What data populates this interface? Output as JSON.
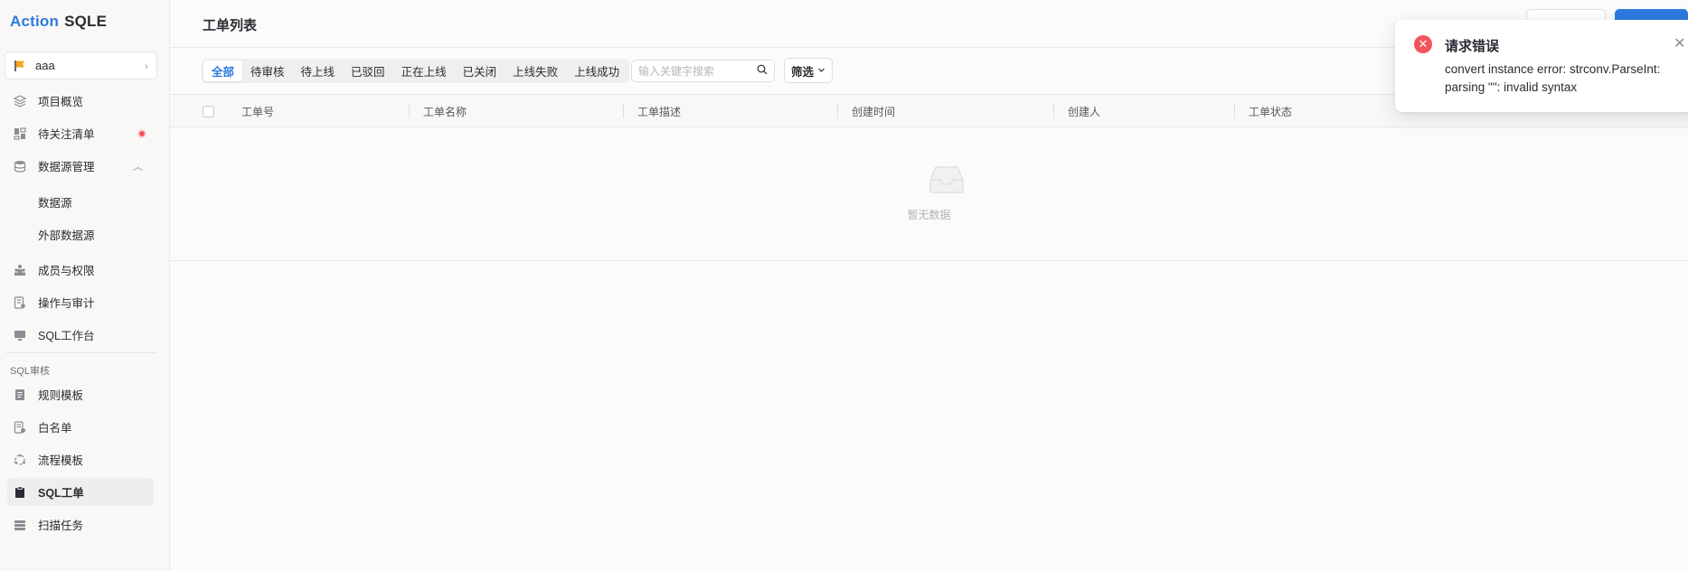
{
  "logo": {
    "brand": "Action",
    "product": "SQLE"
  },
  "project": {
    "name": "aaa"
  },
  "sidebar": {
    "items": [
      {
        "label": "项目概览",
        "icon": "layers-icon"
      },
      {
        "label": "待关注清单",
        "icon": "dashboard-icon",
        "badge": true
      },
      {
        "label": "数据源管理",
        "icon": "database-icon",
        "expanded": true
      },
      {
        "label": "数据源"
      },
      {
        "label": "外部数据源"
      },
      {
        "label": "成员与权限",
        "icon": "members-icon"
      },
      {
        "label": "操作与审计",
        "icon": "audit-icon"
      },
      {
        "label": "SQL工作台",
        "icon": "monitor-icon"
      }
    ],
    "group_label": "SQL审核",
    "group_items": [
      {
        "label": "规则模板",
        "icon": "document-icon"
      },
      {
        "label": "白名单",
        "icon": "whitelist-icon"
      },
      {
        "label": "流程模板",
        "icon": "flow-icon"
      },
      {
        "label": "SQL工单",
        "icon": "clipboard-icon",
        "active": true
      },
      {
        "label": "扫描任务",
        "icon": "scan-icon"
      }
    ]
  },
  "main": {
    "title": "工单列表",
    "tabs": [
      "全部",
      "待审核",
      "待上线",
      "已驳回",
      "正在上线",
      "已关闭",
      "上线失败",
      "上线成功"
    ],
    "active_tab": "全部",
    "search_placeholder": "输入关键字搜索",
    "filter_label": "筛选",
    "columns": [
      "工单号",
      "工单名称",
      "工单描述",
      "创建时间",
      "创建人",
      "工单状态"
    ],
    "empty_text": "暂无数据"
  },
  "toast": {
    "title": "请求错误",
    "message": "convert instance error: strconv.ParseInt: parsing \"\": invalid syntax"
  },
  "colors": {
    "accent": "#2f7ae0",
    "error": "#f2545b",
    "flag": "#f5a623"
  }
}
